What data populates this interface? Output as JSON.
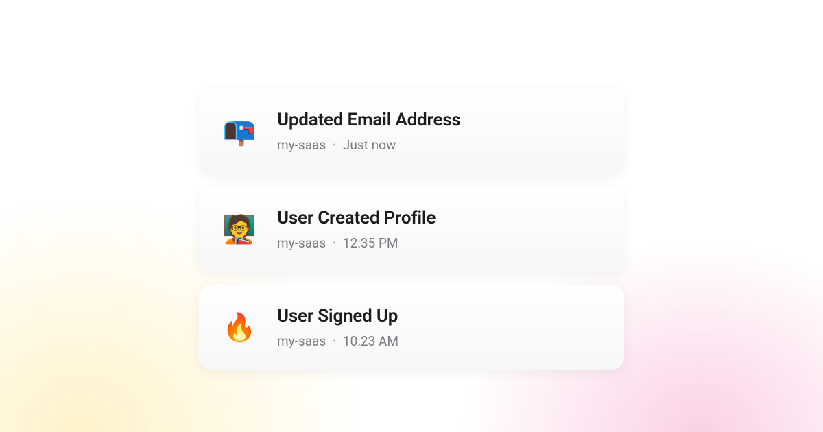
{
  "events": [
    {
      "icon": "📭",
      "icon_name": "mailbox-icon",
      "title": "Updated Email Address",
      "project": "my-saas",
      "timestamp": "Just now"
    },
    {
      "icon": "🧑‍🏫",
      "icon_name": "teacher-icon",
      "title": "User Created Profile",
      "project": "my-saas",
      "timestamp": "12:35 PM"
    },
    {
      "icon": "🔥",
      "icon_name": "fire-icon",
      "title": "User Signed Up",
      "project": "my-saas",
      "timestamp": "10:23 AM"
    }
  ]
}
